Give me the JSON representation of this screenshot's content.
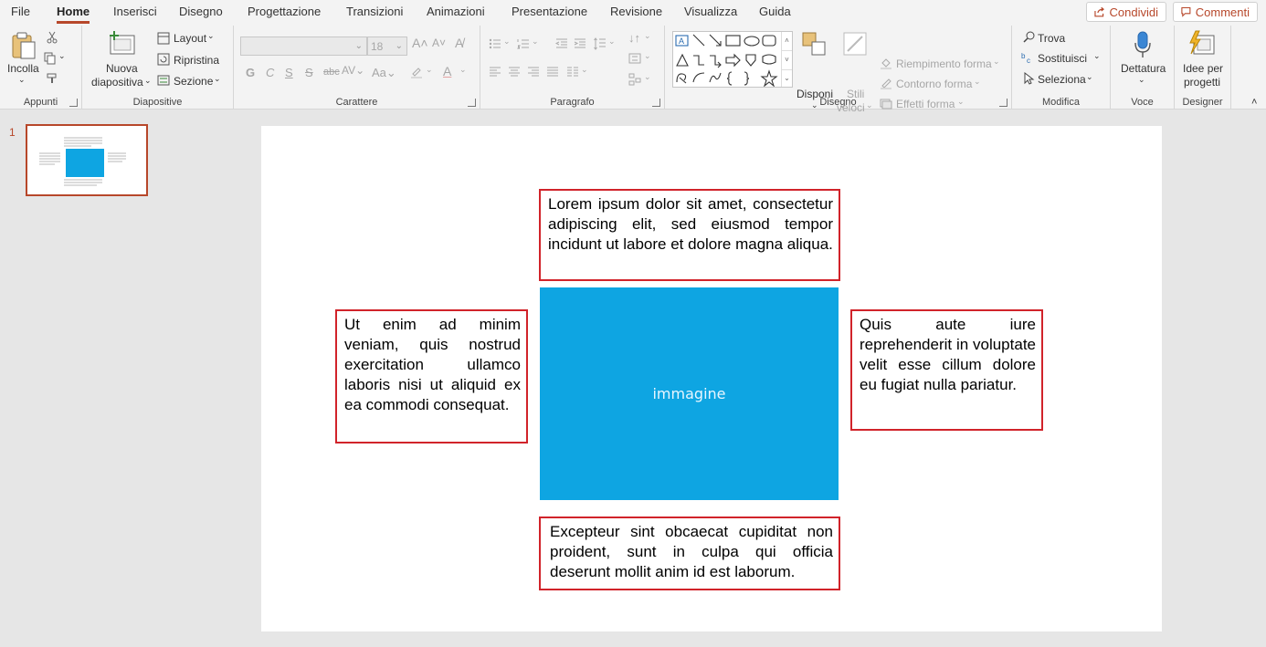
{
  "menu": {
    "tabs": [
      "File",
      "Home",
      "Inserisci",
      "Disegno",
      "Progettazione",
      "Transizioni",
      "Animazioni",
      "Presentazione",
      "Revisione",
      "Visualizza",
      "Guida"
    ],
    "share_label": "Condividi",
    "comments_label": "Commenti"
  },
  "ribbon": {
    "appunti": {
      "paste_label": "Incolla",
      "group_label": "Appunti"
    },
    "diapositive": {
      "new_slide_line1": "Nuova",
      "new_slide_line2": "diapositiva",
      "layout_label": "Layout",
      "reset_label": "Ripristina",
      "section_label": "Sezione",
      "group_label": "Diapositive"
    },
    "carattere": {
      "font_name": "",
      "font_size": "18",
      "group_label": "Carattere"
    },
    "paragrafo": {
      "group_label": "Paragrafo"
    },
    "disegno": {
      "arrange_label": "Disponi",
      "styles_line1": "Stili",
      "styles_line2": "veloci",
      "fill_label": "Riempimento forma",
      "outline_label": "Contorno forma",
      "effects_label": "Effetti forma",
      "group_label": "Disegno"
    },
    "modifica": {
      "find_label": "Trova",
      "replace_label": "Sostituisci",
      "select_label": "Seleziona",
      "group_label": "Modifica"
    },
    "voce": {
      "dictate_label": "Dettatura",
      "group_label": "Voce"
    },
    "designer": {
      "ideas_line1": "Idee per",
      "ideas_line2": "progetti",
      "group_label": "Designer"
    }
  },
  "slides_pane": {
    "slide_number": "1"
  },
  "slide": {
    "text_top": "Lorem ipsum dolor sit amet, consectetur adipiscing elit, sed eiusmod tempor incidunt ut labore et dolore magna aliqua.",
    "text_left": "Ut enim ad minim veniam, quis nostrud exercitation ullamco laboris nisi ut aliquid ex ea commodi consequat.",
    "text_right": "Quis aute iure reprehenderit in voluptate velit esse cillum dolore eu fugiat nulla pariatur.",
    "text_bottom": "Excepteur sint obcaecat cupiditat non proident, sunt in culpa qui officia deserunt mollit anim id est laborum.",
    "image_label": "immagine"
  },
  "colors": {
    "accent": "#b7472a",
    "textbox_border": "#d1232a",
    "image_fill": "#0ea5e2"
  }
}
